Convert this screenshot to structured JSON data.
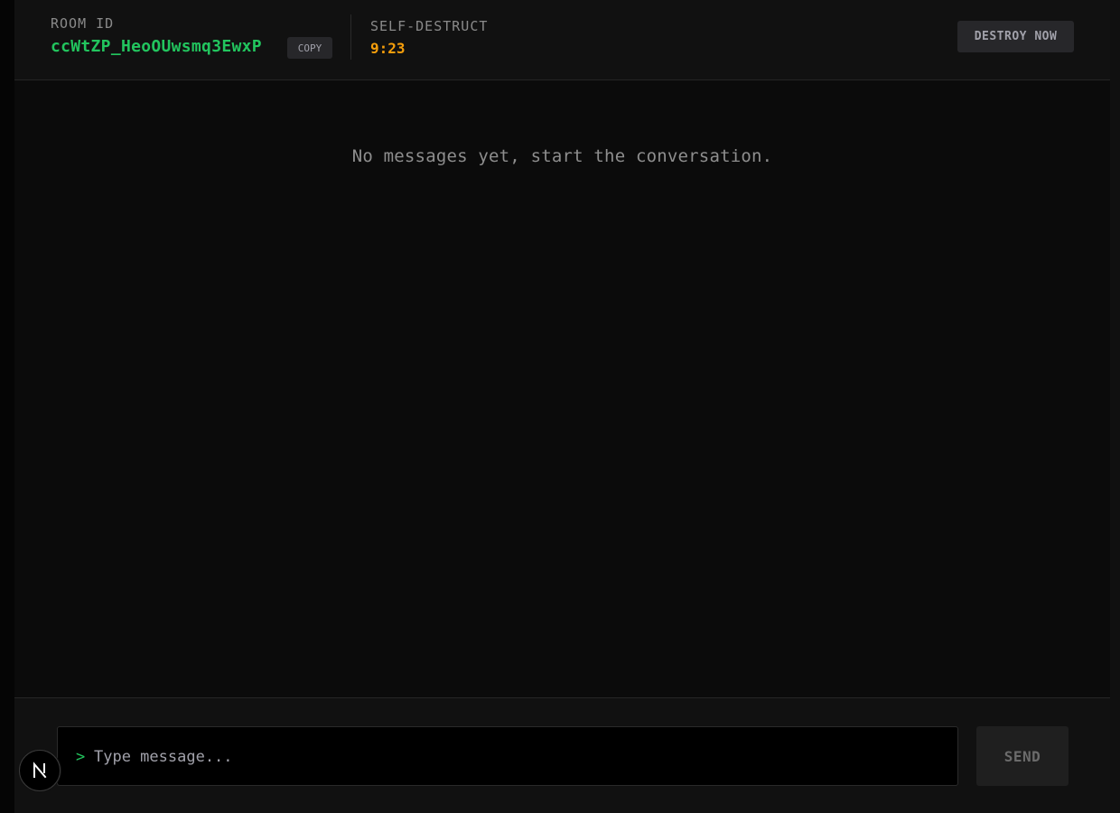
{
  "header": {
    "room_label": "ROOM ID",
    "room_id": "ccWtZP_HeoOUwsmq3EwxP",
    "copy_label": "COPY",
    "self_destruct_label": "SELF-DESTRUCT",
    "timer": "9:23",
    "destroy_label": "DESTROY NOW"
  },
  "messages": {
    "empty_text": "No messages yet, start the conversation."
  },
  "composer": {
    "prompt_symbol": ">",
    "placeholder": "Type message...",
    "send_label": "SEND"
  },
  "colors": {
    "accent_green": "#22c55e",
    "timer_amber": "#f59e0b",
    "background": "#0b0b0b"
  },
  "icons": {
    "dev_indicator": "nextjs-logo-icon"
  }
}
